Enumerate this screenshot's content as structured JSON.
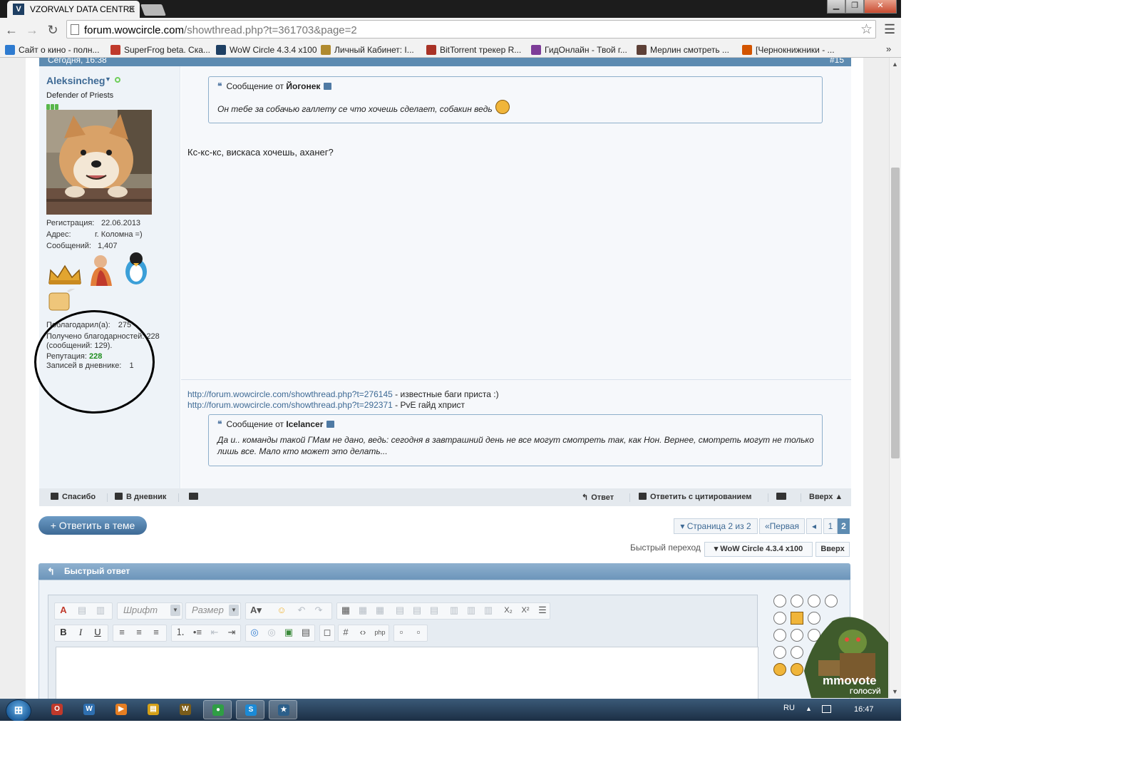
{
  "browser": {
    "tab_title": "VZORVALY DATA CENTRE",
    "tab_favicon": "V",
    "url_domain": "forum.wowcircle.com",
    "url_rest": "/showthread.php?t=361703&page=2",
    "bookmarks": [
      {
        "label": "Сайт о кино - полн...",
        "icon": "c-icon",
        "color": "#2e7bd0"
      },
      {
        "label": "SuperFrog beta. Ска...",
        "icon": "frog-icon",
        "color": "#c0392b"
      },
      {
        "label": "WoW Circle 4.3.4 x100",
        "icon": "wowcircle-icon",
        "color": "#1e3f63"
      },
      {
        "label": "Личный Кабинет: I...",
        "icon": "wow-icon",
        "color": "#b08a2e"
      },
      {
        "label": "BitTorrent трекер R...",
        "icon": "torrent-icon",
        "color": "#a93226"
      },
      {
        "label": "ГидОнлайн - Твой г...",
        "icon": "film-icon",
        "color": "#7d3c98"
      },
      {
        "label": "Мерлин смотреть ...",
        "icon": "movie-icon",
        "color": "#5d4037"
      },
      {
        "label": "[Чернокнижники - ...",
        "icon": "warlock-icon",
        "color": "#d35400"
      }
    ],
    "bookmarks_more": "»"
  },
  "post": {
    "date": "Сегодня, 16:38",
    "number": "#15",
    "user": {
      "name": "Aleksincheg",
      "title": "Defender of Priests",
      "reg_label": "Регистрация:",
      "reg_value": "22.06.2013",
      "addr_label": "Адрес:",
      "addr_value": "г. Коломна =)",
      "posts_label": "Сообщений:",
      "posts_value": "1,407",
      "thanked_label": "Поблагодарил(а):",
      "thanked_value": "275",
      "received_label": "Получено благодарностей:",
      "received_value": "228",
      "received_note": "(сообщений: 129).",
      "rep_label": "Репутация:",
      "rep_value": "228",
      "diary_label": "Записей в дневнике:",
      "diary_value": "1"
    },
    "quote1": {
      "prefix": "Сообщение от",
      "author": "Йогонек",
      "text": "Он тебе за собачью галлету се что хочешь сделает, собакин ведь"
    },
    "message": "Кс-кс-кс, вискаса хочешь, аханег?",
    "signature": {
      "link1": "http://forum.wowcircle.com/showthread.php?t=276145",
      "link1_text": " - известные баги приста :)",
      "link2": "http://forum.wowcircle.com/showthread.php?t=292371",
      "link2_text": " - PvE гайд хприст",
      "quote_prefix": "Сообщение от",
      "quote_author": "Icelancer",
      "quote_line1": "Да и.. команды такой ГМам не дано, ведь: сегодня в завтрашний день не все могут смотреть так, как Нон. Вернее, смотреть могут не только",
      "quote_line2": "лишь все. Мало кто может это делать..."
    },
    "footer": {
      "thanks": "Спасибо",
      "diary": "В дневник",
      "reply": "Ответ",
      "reply_quote": "Ответить с цитированием",
      "top": "Вверх ▲"
    }
  },
  "thread": {
    "reply_button": "+ Ответить в теме",
    "page_of": "▾ Страница 2 из 2",
    "first": "«Первая",
    "prev": "◂",
    "page1": "1",
    "page2": "2",
    "quick_jump_label": "Быстрый переход",
    "quick_jump_value": "▾ WoW Circle 4.3.4 x100",
    "quick_jump_top": "Вверх"
  },
  "quick_reply": {
    "title": "Быстрый ответ",
    "font_placeholder": "Шрифт",
    "size_placeholder": "Размер"
  },
  "mmovote": {
    "brand": "mmovote",
    "sub": "ГОЛОСУЙ"
  },
  "taskbar": {
    "lang": "RU",
    "time": "16:47",
    "apps": [
      {
        "name": "opera-icon",
        "color": "#c0392b",
        "glyph": "O"
      },
      {
        "name": "wow-launcher-icon",
        "color": "#2e6fb0",
        "glyph": "W"
      },
      {
        "name": "media-player-icon",
        "color": "#e67e22",
        "glyph": "▶"
      },
      {
        "name": "explorer-icon",
        "color": "#d4a017",
        "glyph": "▤"
      },
      {
        "name": "wow-icon",
        "color": "#7a5c1a",
        "glyph": "W"
      },
      {
        "name": "chrome-icon",
        "color": "#2f9e44",
        "glyph": "●"
      },
      {
        "name": "skype-icon",
        "color": "#1b8ad6",
        "glyph": "S"
      },
      {
        "name": "star-app-icon",
        "color": "#2c5f8a",
        "glyph": "★"
      }
    ]
  }
}
